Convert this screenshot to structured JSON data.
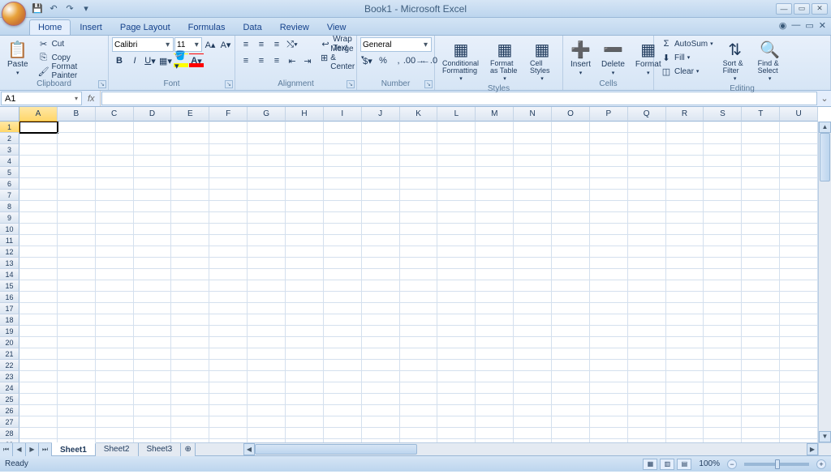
{
  "title": "Book1 - Microsoft Excel",
  "qat": {
    "save": "Save",
    "undo": "Undo",
    "redo": "Redo"
  },
  "tabs": [
    "Home",
    "Insert",
    "Page Layout",
    "Formulas",
    "Data",
    "Review",
    "View"
  ],
  "active_tab": "Home",
  "clipboard": {
    "paste": "Paste",
    "cut": "Cut",
    "copy": "Copy",
    "format_painter": "Format Painter",
    "label": "Clipboard"
  },
  "font": {
    "name": "Calibri",
    "size": "11",
    "label": "Font"
  },
  "alignment": {
    "wrap": "Wrap Text",
    "merge": "Merge & Center",
    "label": "Alignment"
  },
  "number": {
    "format": "General",
    "label": "Number"
  },
  "styles": {
    "cond": "Conditional Formatting",
    "table": "Format as Table",
    "cell": "Cell Styles",
    "label": "Styles"
  },
  "cells": {
    "insert": "Insert",
    "delete": "Delete",
    "format": "Format",
    "label": "Cells"
  },
  "editing": {
    "sum": "AutoSum",
    "fill": "Fill",
    "clear": "Clear",
    "sort": "Sort & Filter",
    "find": "Find & Select",
    "label": "Editing"
  },
  "namebox": "A1",
  "columns": [
    "A",
    "B",
    "C",
    "D",
    "E",
    "F",
    "G",
    "H",
    "I",
    "J",
    "K",
    "L",
    "M",
    "N",
    "O",
    "P",
    "Q",
    "R",
    "S",
    "T",
    "U"
  ],
  "rows": 29,
  "sheets": [
    "Sheet1",
    "Sheet2",
    "Sheet3"
  ],
  "active_sheet": "Sheet1",
  "status": "Ready",
  "zoom": "100%"
}
